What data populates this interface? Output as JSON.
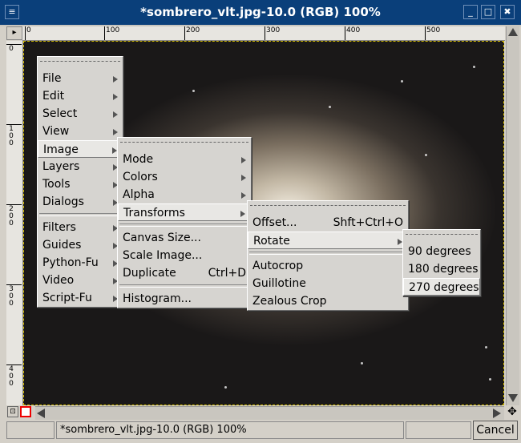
{
  "window": {
    "title": "*sombrero_vlt.jpg-10.0 (RGB) 100%",
    "menu_glyph": "≡",
    "min_glyph": "_",
    "max_glyph": "□",
    "close_glyph": "✖"
  },
  "ruler_top": [
    "0",
    "100",
    "200",
    "300",
    "400",
    "500"
  ],
  "ruler_left": [
    [
      "0"
    ],
    [
      "1",
      "0",
      "0"
    ],
    [
      "2",
      "0",
      "0"
    ],
    [
      "3",
      "0",
      "0"
    ],
    [
      "4",
      "0",
      "0"
    ]
  ],
  "menu_main": {
    "items": [
      {
        "label": "File",
        "submenu": true
      },
      {
        "label": "Edit",
        "submenu": true
      },
      {
        "label": "Select",
        "submenu": true
      },
      {
        "label": "View",
        "submenu": true
      },
      {
        "label": "Image",
        "submenu": true,
        "active": true
      },
      {
        "label": "Layers",
        "submenu": true
      },
      {
        "label": "Tools",
        "submenu": true
      },
      {
        "label": "Dialogs",
        "submenu": true
      },
      {
        "separator": true
      },
      {
        "label": "Filters",
        "submenu": true
      },
      {
        "label": "Guides",
        "submenu": true
      },
      {
        "label": "Python-Fu",
        "submenu": true
      },
      {
        "label": "Video",
        "submenu": true
      },
      {
        "label": "Script-Fu",
        "submenu": true
      }
    ]
  },
  "menu_image": {
    "items": [
      {
        "label": "Mode",
        "submenu": true
      },
      {
        "label": "Colors",
        "submenu": true
      },
      {
        "label": "Alpha",
        "submenu": true
      },
      {
        "label": "Transforms",
        "submenu": true,
        "active": true
      },
      {
        "separator": true
      },
      {
        "label": "Canvas Size..."
      },
      {
        "label": "Scale Image..."
      },
      {
        "label": "Duplicate",
        "accel": "Ctrl+D"
      },
      {
        "separator": true
      },
      {
        "label": "Histogram..."
      }
    ]
  },
  "menu_transforms": {
    "items": [
      {
        "label": "Offset...",
        "accel": "Shft+Ctrl+O"
      },
      {
        "label": "Rotate",
        "submenu": true,
        "active": true
      },
      {
        "separator": true
      },
      {
        "label": "Autocrop"
      },
      {
        "label": "Guillotine"
      },
      {
        "label": "Zealous Crop"
      }
    ]
  },
  "menu_rotate": {
    "items": [
      {
        "label": "90 degrees"
      },
      {
        "label": "180 degrees"
      },
      {
        "label": "270 degrees",
        "active": true
      }
    ]
  },
  "status": {
    "text": "*sombrero_vlt.jpg-10.0 (RGB) 100%",
    "cancel_label": "Cancel",
    "nav_glyph": "✥"
  },
  "colors": {
    "titlebar": "#0a3f7a",
    "guide": "#d8c000",
    "quickmask": "#e00000"
  }
}
